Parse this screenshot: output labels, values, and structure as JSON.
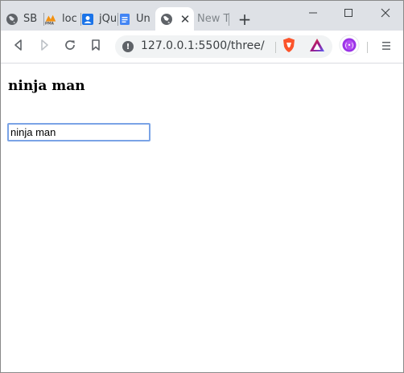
{
  "tabs": [
    {
      "label": "SB",
      "icon": "globe-icon",
      "active": false
    },
    {
      "label": "loc",
      "icon": "phpmyadmin-icon",
      "active": false
    },
    {
      "label": "jQu",
      "icon": "contacts-icon",
      "active": false
    },
    {
      "label": "Un",
      "icon": "docs-icon",
      "active": false
    },
    {
      "label": "",
      "icon": "globe-icon",
      "active": true,
      "close": "✕"
    },
    {
      "label": "New Ta",
      "icon": "",
      "active": false
    }
  ],
  "new_tab_label": "+",
  "window_controls": {
    "minimize": "minimize-icon",
    "maximize": "maximize-icon",
    "close": "close-icon"
  },
  "toolbar": {
    "back": "back-icon",
    "forward": "forward-icon",
    "reload": "reload-icon",
    "bookmark": "bookmark-icon",
    "url": "127.0.0.1:5500/three/",
    "info_glyph": "!",
    "brave_shield": "brave-shield-icon",
    "brave_rewards": "brave-rewards-icon",
    "profile_avatar": "profile-avatar-icon",
    "menu": "menu-icon"
  },
  "page": {
    "heading": "ninja man",
    "input_value": "ninja man"
  },
  "colors": {
    "tabstrip_bg": "#dee1e6",
    "omnibox_bg": "#f1f3f4",
    "brave_orange": "#fb542b",
    "rewards_purple": "#a0147f",
    "focus_ring": "#7aa3e6"
  }
}
